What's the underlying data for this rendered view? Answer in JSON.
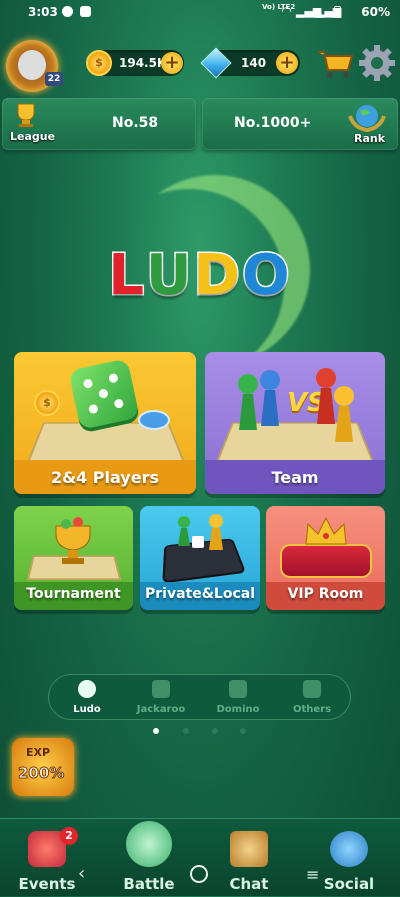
{
  "status": {
    "time": "3:03",
    "network": "Vo) LTE2",
    "battery": "60%"
  },
  "player": {
    "level": "22"
  },
  "currency": {
    "coins": "194.5K",
    "gems": "140"
  },
  "league": {
    "label": "League",
    "rank_value": "No.58"
  },
  "global_rank": {
    "label": "Rank",
    "rank_value": "No.1000+"
  },
  "logo": {
    "letters": [
      "L",
      "U",
      "D",
      "O"
    ],
    "colors": [
      "#e0232b",
      "#2f9b3f",
      "#f5c117",
      "#1e88d6"
    ]
  },
  "modes": {
    "players": "2&4 Players",
    "team": "Team",
    "tournament": "Tournament",
    "private": "Private&Local",
    "vip": "VIP Room"
  },
  "game_tabs": [
    "Ludo",
    "Jackaroo",
    "Domino",
    "Others"
  ],
  "promo": {
    "badge": "EXP",
    "value": "200%"
  },
  "nav": {
    "events": "Events",
    "events_badge": "2",
    "battle": "Battle",
    "chat": "Chat",
    "social": "Social"
  },
  "colors": {
    "accent_green": "#1d7a52",
    "gold": "#f2a50c",
    "card_purple": "#8a6fd4",
    "card_orange": "#f1aa1c"
  }
}
